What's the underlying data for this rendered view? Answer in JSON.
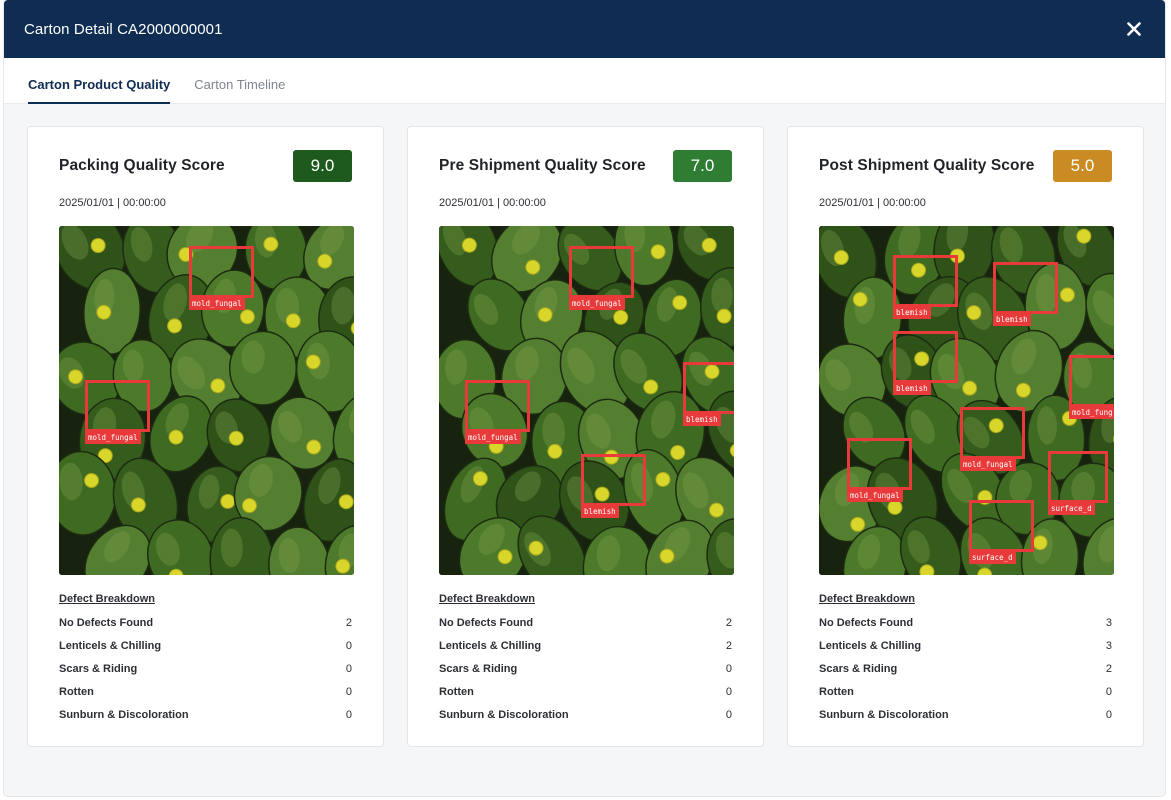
{
  "header": {
    "title": "Carton Detail CA2000000001"
  },
  "tabs": [
    {
      "label": "Carton Product Quality",
      "active": true
    },
    {
      "label": "Carton Timeline",
      "active": false
    }
  ],
  "cards": [
    {
      "title": "Packing Quality Score",
      "score": "9.0",
      "score_color": "#1e5a1e",
      "date": "2025/01/01 | 00:00:00",
      "detections": [
        "mold_fungal",
        "mold_fungal"
      ],
      "breakdown_title": "Defect Breakdown",
      "rows": [
        {
          "label": "No Defects Found",
          "value": "2"
        },
        {
          "label": "Lenticels & Chilling",
          "value": "0"
        },
        {
          "label": "Scars & Riding",
          "value": "0"
        },
        {
          "label": "Rotten",
          "value": "0"
        },
        {
          "label": "Sunburn & Discoloration",
          "value": "0"
        }
      ]
    },
    {
      "title": "Pre Shipment Quality Score",
      "score": "7.0",
      "score_color": "#2e7d32",
      "date": "2025/01/01 | 00:00:00",
      "detections": [
        "mold_fungal",
        "mold_fungal",
        "blemish",
        "blemish"
      ],
      "breakdown_title": "Defect Breakdown",
      "rows": [
        {
          "label": "No Defects Found",
          "value": "2"
        },
        {
          "label": "Lenticels & Chilling",
          "value": "2"
        },
        {
          "label": "Scars & Riding",
          "value": "0"
        },
        {
          "label": "Rotten",
          "value": "0"
        },
        {
          "label": "Sunburn & Discoloration",
          "value": "0"
        }
      ]
    },
    {
      "title": "Post Shipment Quality Score",
      "score": "5.0",
      "score_color": "#c98b22",
      "date": "2025/01/01 | 00:00:00",
      "detections": [
        "blemish",
        "blemish",
        "blemish",
        "mold_fung",
        "mold_fungal",
        "mold_fungal",
        "surface_d",
        "surface_d"
      ],
      "breakdown_title": "Defect Breakdown",
      "rows": [
        {
          "label": "No Defects Found",
          "value": "3"
        },
        {
          "label": "Lenticels & Chilling",
          "value": "3"
        },
        {
          "label": "Scars & Riding",
          "value": "2"
        },
        {
          "label": "Rotten",
          "value": "0"
        },
        {
          "label": "Sunburn & Discoloration",
          "value": "0"
        }
      ]
    }
  ]
}
